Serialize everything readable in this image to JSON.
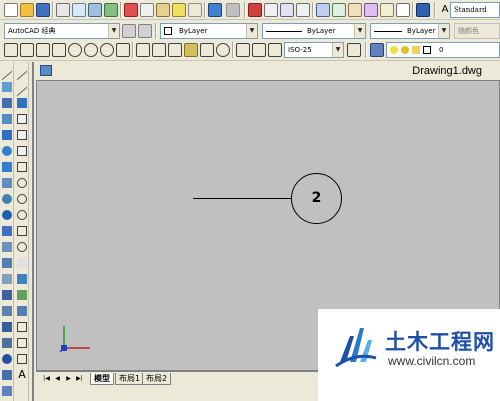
{
  "document": {
    "title": "Drawing1.dwg"
  },
  "toolbar": {
    "text_style_value": "Standard",
    "workspace_value": "AutoCAD 经典",
    "layer_value": "ByLayer",
    "linetype_value": "ByLayer",
    "lineweight_value": "ByLayer",
    "color_value": "随颜色",
    "dimstyle_value": "ISO-25",
    "layer_current": "0"
  },
  "drawing": {
    "balloon_number": "2"
  },
  "layout_tabs": [
    {
      "label": "模型",
      "active": true
    },
    {
      "label": "布局1",
      "active": false
    },
    {
      "label": "布局2",
      "active": false
    }
  ],
  "watermark": {
    "title": "土木工程网",
    "url": "www.civilcn.com"
  },
  "colors": {
    "canvas_bg": "#c0c0c0",
    "toolbar_bg": "#ece9d8",
    "watermark_blue": "#1f4fa8"
  }
}
